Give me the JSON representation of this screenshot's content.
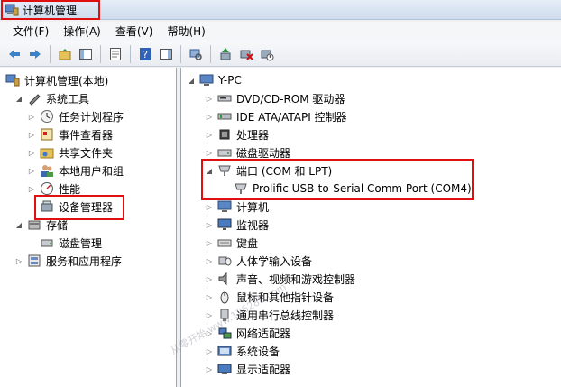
{
  "window": {
    "title": "计算机管理"
  },
  "menu": [
    "文件(F)",
    "操作(A)",
    "查看(V)",
    "帮助(H)"
  ],
  "left_tree": [
    {
      "label": "计算机管理(本地)",
      "icon": "computer-mgmt-icon"
    },
    {
      "label": "系统工具",
      "icon": "tools-icon"
    },
    {
      "label": "任务计划程序",
      "icon": "clock-icon"
    },
    {
      "label": "事件查看器",
      "icon": "event-viewer-icon"
    },
    {
      "label": "共享文件夹",
      "icon": "shared-folder-icon"
    },
    {
      "label": "本地用户和组",
      "icon": "users-icon"
    },
    {
      "label": "性能",
      "icon": "performance-icon"
    },
    {
      "label": "设备管理器",
      "icon": "device-manager-icon"
    },
    {
      "label": "存储",
      "icon": "storage-icon"
    },
    {
      "label": "磁盘管理",
      "icon": "disk-mgmt-icon"
    },
    {
      "label": "服务和应用程序",
      "icon": "services-icon"
    }
  ],
  "right_tree": {
    "root": "Y-PC",
    "items": [
      {
        "label": "DVD/CD-ROM 驱动器",
        "icon": "dvd-icon"
      },
      {
        "label": "IDE ATA/ATAPI 控制器",
        "icon": "ide-icon"
      },
      {
        "label": "处理器",
        "icon": "cpu-icon"
      },
      {
        "label": "磁盘驱动器",
        "icon": "disk-icon"
      },
      {
        "label": "端口 (COM 和 LPT)",
        "icon": "port-icon"
      },
      {
        "label": "Prolific USB-to-Serial Comm Port (COM4)",
        "icon": "port-icon"
      },
      {
        "label": "计算机",
        "icon": "computer-icon"
      },
      {
        "label": "监视器",
        "icon": "monitor-icon"
      },
      {
        "label": "键盘",
        "icon": "keyboard-icon"
      },
      {
        "label": "人体学输入设备",
        "icon": "hid-icon"
      },
      {
        "label": "声音、视频和游戏控制器",
        "icon": "sound-icon"
      },
      {
        "label": "鼠标和其他指针设备",
        "icon": "mouse-icon"
      },
      {
        "label": "通用串行总线控制器",
        "icon": "usb-icon"
      },
      {
        "label": "网络适配器",
        "icon": "network-icon"
      },
      {
        "label": "系统设备",
        "icon": "system-device-icon"
      },
      {
        "label": "显示适配器",
        "icon": "display-adapter-icon"
      }
    ]
  },
  "watermark": "从零开始 www.126288.com"
}
